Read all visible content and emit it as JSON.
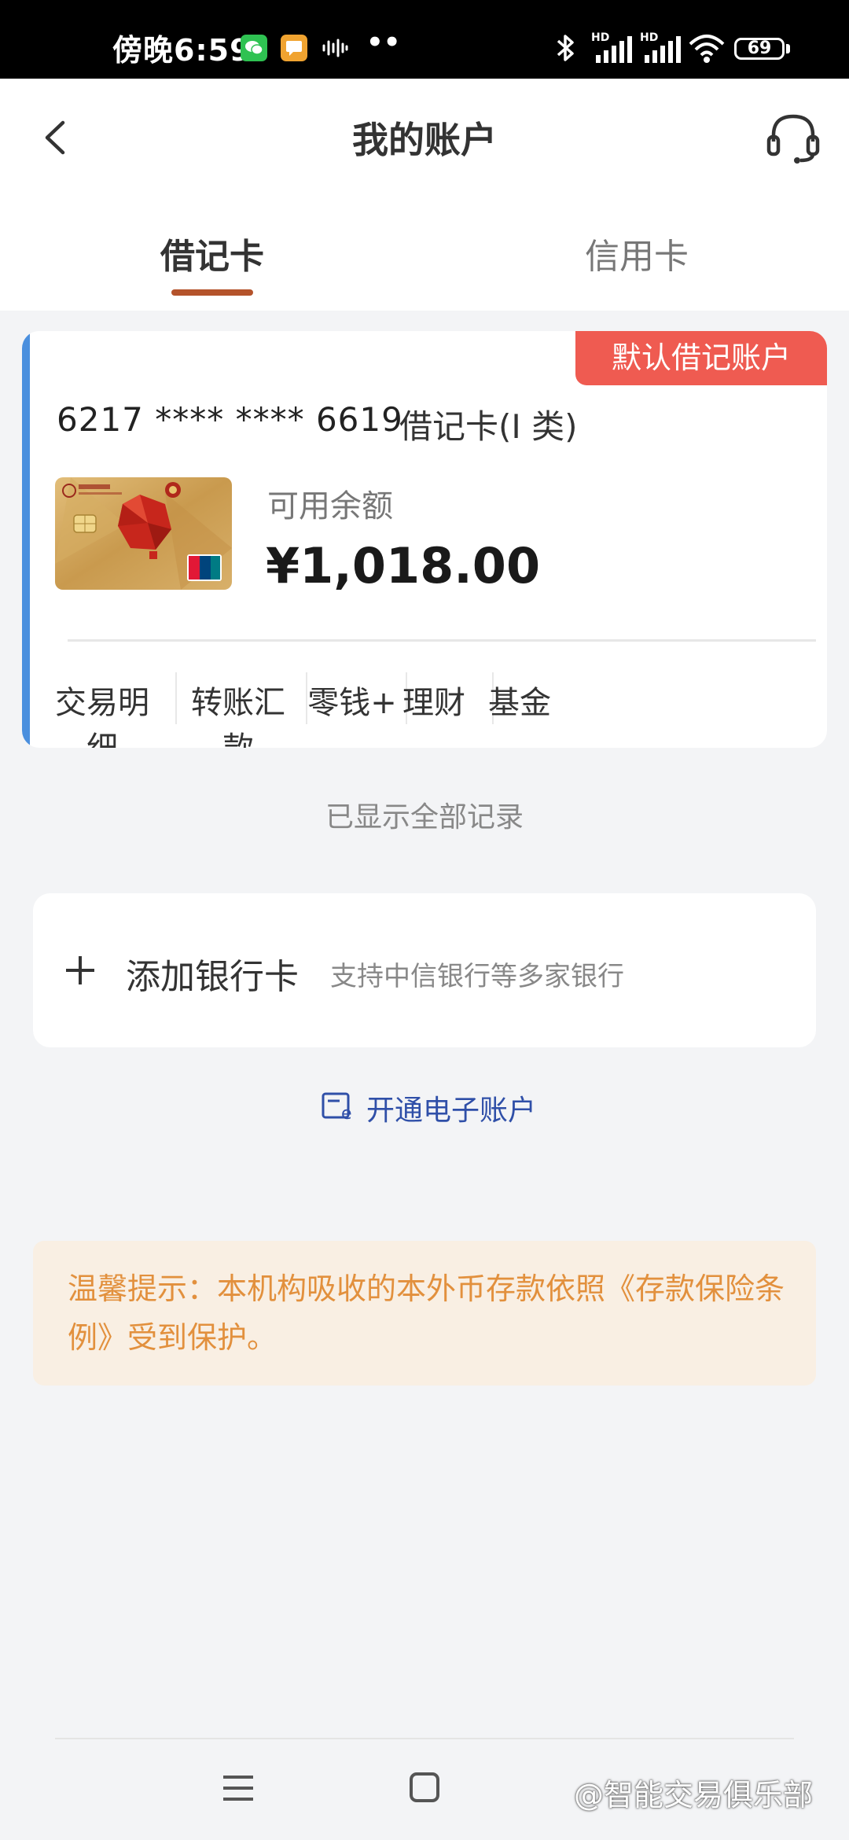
{
  "status_bar": {
    "time": "傍晚6:59",
    "battery": "69",
    "dots": "••"
  },
  "header": {
    "title": "我的账户"
  },
  "tabs": [
    {
      "label": "借记卡",
      "active": true
    },
    {
      "label": "信用卡",
      "active": false
    }
  ],
  "account": {
    "badge": "默认借记账户",
    "card_number": "6217 **** **** 6619",
    "card_type": "借记卡(I 类)",
    "balance_label": "可用余额",
    "balance": "¥1,018.00",
    "actions": [
      "交易明细",
      "转账汇款",
      "零钱+",
      "理财",
      "基金"
    ]
  },
  "records_note": "已显示全部记录",
  "add_card": {
    "label": "添加银行卡",
    "sub": "支持中信银行等多家银行"
  },
  "e_account": {
    "label": "开通电子账户"
  },
  "tip": {
    "text": "温馨提示：本机构吸收的本外币存款依照《存款保险条例》受到保护。"
  },
  "watermark": "@智能交易俱乐部",
  "colors": {
    "accent_blue": "#4a8fde",
    "badge_red": "#ef5b51",
    "tab_underline": "#b4532b",
    "link_blue": "#2f4fa8",
    "tip_orange": "#e2903d",
    "tip_bg": "#f9efe3"
  },
  "icons": {
    "back": "back-arrow-icon",
    "service": "headset-icon",
    "plus": "plus-icon",
    "e_account": "e-card-icon",
    "nav_menu": "menu-icon",
    "nav_home": "home-square-icon"
  }
}
